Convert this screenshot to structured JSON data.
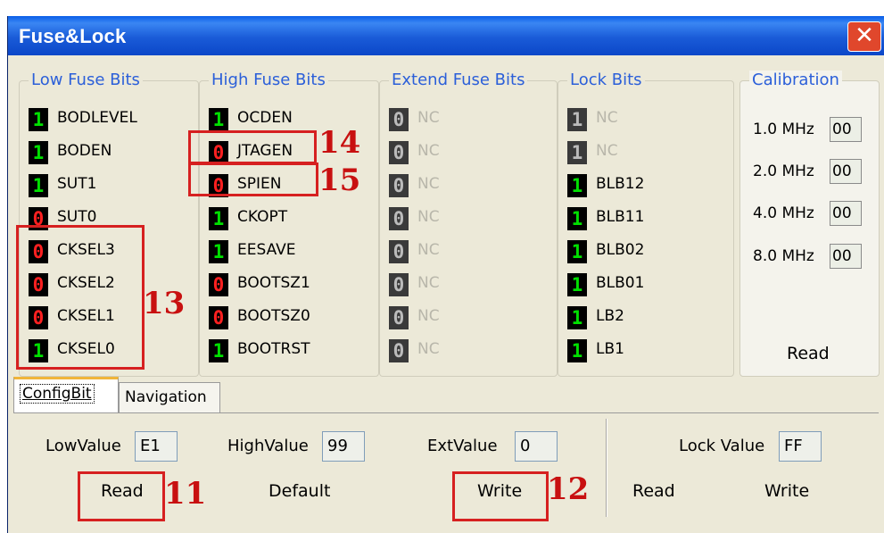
{
  "window": {
    "title": "Fuse&Lock",
    "close_glyph": "✕"
  },
  "groups": {
    "low": {
      "title": "Low Fuse Bits",
      "bits": [
        {
          "value": "1",
          "label": "BODLEVEL"
        },
        {
          "value": "1",
          "label": "BODEN"
        },
        {
          "value": "1",
          "label": "SUT1"
        },
        {
          "value": "0",
          "label": "SUT0"
        },
        {
          "value": "0",
          "label": "CKSEL3"
        },
        {
          "value": "0",
          "label": "CKSEL2"
        },
        {
          "value": "0",
          "label": "CKSEL1"
        },
        {
          "value": "1",
          "label": "CKSEL0"
        }
      ]
    },
    "high": {
      "title": "High Fuse Bits",
      "bits": [
        {
          "value": "1",
          "label": "OCDEN"
        },
        {
          "value": "0",
          "label": "JTAGEN"
        },
        {
          "value": "0",
          "label": "SPIEN"
        },
        {
          "value": "1",
          "label": "CKOPT"
        },
        {
          "value": "1",
          "label": "EESAVE"
        },
        {
          "value": "0",
          "label": "BOOTSZ1"
        },
        {
          "value": "0",
          "label": "BOOTSZ0"
        },
        {
          "value": "1",
          "label": "BOOTRST"
        }
      ]
    },
    "ext": {
      "title": "Extend Fuse Bits",
      "bits": [
        {
          "value": "0",
          "label": "NC"
        },
        {
          "value": "0",
          "label": "NC"
        },
        {
          "value": "0",
          "label": "NC"
        },
        {
          "value": "0",
          "label": "NC"
        },
        {
          "value": "0",
          "label": "NC"
        },
        {
          "value": "0",
          "label": "NC"
        },
        {
          "value": "0",
          "label": "NC"
        },
        {
          "value": "0",
          "label": "NC"
        }
      ]
    },
    "lock": {
      "title": "Lock Bits",
      "bits": [
        {
          "value": "1",
          "label": "NC"
        },
        {
          "value": "1",
          "label": "NC"
        },
        {
          "value": "1",
          "label": "BLB12"
        },
        {
          "value": "1",
          "label": "BLB11"
        },
        {
          "value": "1",
          "label": "BLB02"
        },
        {
          "value": "1",
          "label": "BLB01"
        },
        {
          "value": "1",
          "label": "LB2"
        },
        {
          "value": "1",
          "label": "LB1"
        }
      ]
    }
  },
  "calibration": {
    "title": "Calibration",
    "rows": [
      {
        "label": "1.0 MHz",
        "value": "00"
      },
      {
        "label": "2.0 MHz",
        "value": "00"
      },
      {
        "label": "4.0 MHz",
        "value": "00"
      },
      {
        "label": "8.0 MHz",
        "value": "00"
      }
    ],
    "read_label": "Read"
  },
  "tabs": [
    "ConfigBit",
    "Navigation"
  ],
  "config": {
    "low_label": "LowValue",
    "low_value": "E1",
    "high_label": "HighValue",
    "high_value": "99",
    "ext_label": "ExtValue",
    "ext_value": "0",
    "read_label": "Read",
    "default_label": "Default",
    "write_label": "Write",
    "lock_label": "Lock Value",
    "lock_value": "FF",
    "lock_read_label": "Read",
    "lock_write_label": "Write"
  },
  "callouts": [
    "11",
    "12",
    "13",
    "14",
    "15"
  ],
  "colors": {
    "bit_on": "#00e000",
    "bit_off": "#ff2020",
    "legend": "#2b5fd9",
    "callout": "#d62020"
  }
}
